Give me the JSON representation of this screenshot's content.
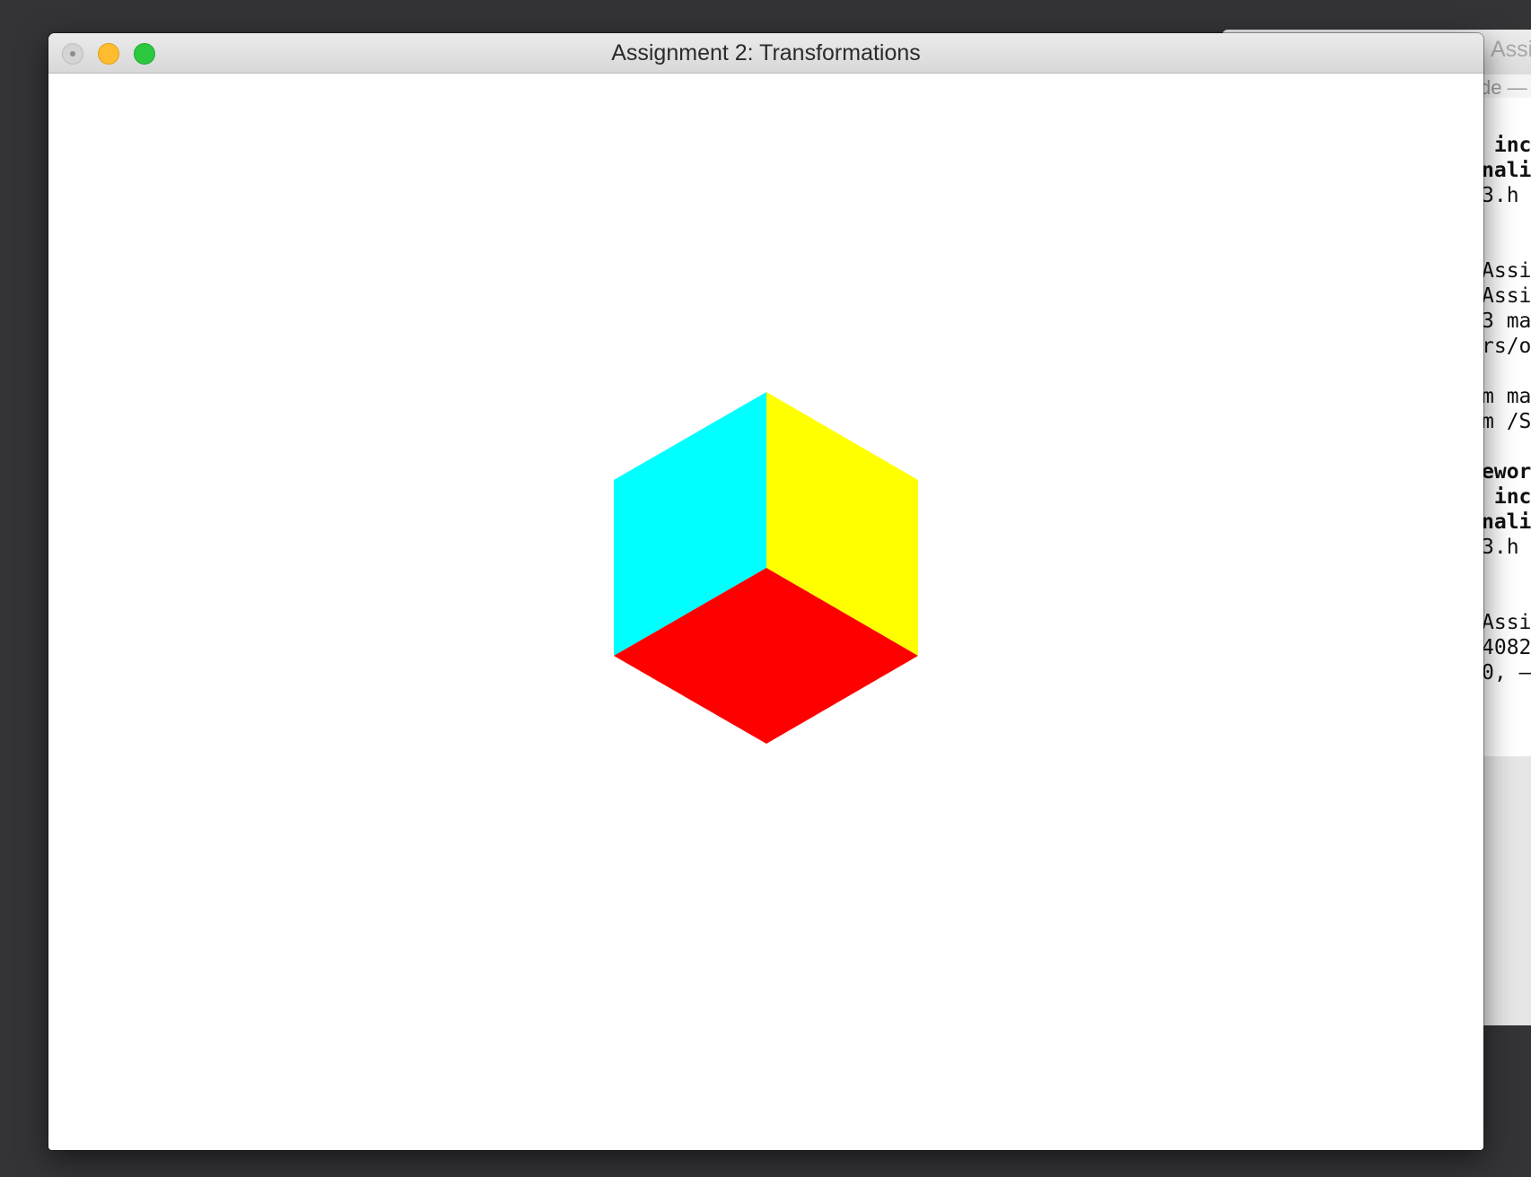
{
  "main_window": {
    "title": "Assignment 2: Transformations",
    "buttons": {
      "close": "close",
      "minimize": "minimize",
      "zoom": "zoom"
    },
    "canvas": {
      "background": "#ffffff",
      "cube_faces": {
        "left": "#00ffff",
        "right": "#ffff00",
        "bottom": "#ff0000"
      }
    }
  },
  "background_window": {
    "title": "Assi",
    "subtitle": "de —",
    "terminal_lines": [
      {
        "text": " inc",
        "bold": true
      },
      {
        "text": "nali",
        "bold": true
      },
      {
        "text": "3.h",
        "bold": false
      },
      {
        "text": "",
        "bold": false
      },
      {
        "text": "",
        "bold": false
      },
      {
        "text": "Assi",
        "bold": false
      },
      {
        "text": "Assi",
        "bold": false
      },
      {
        "text": "3 ma",
        "bold": false
      },
      {
        "text": "rs/o",
        "bold": false
      },
      {
        "text": "",
        "bold": false
      },
      {
        "text": "m ma",
        "bold": false
      },
      {
        "text": "m /S",
        "bold": false
      },
      {
        "text": "",
        "bold": false
      },
      {
        "text": "ewor",
        "bold": true
      },
      {
        "text": " inc",
        "bold": true
      },
      {
        "text": "nali",
        "bold": true
      },
      {
        "text": "3.h",
        "bold": false
      },
      {
        "text": "",
        "bold": false
      },
      {
        "text": "",
        "bold": false
      },
      {
        "text": "Assi",
        "bold": false
      },
      {
        "text": "4082",
        "bold": false
      },
      {
        "text": "0, –",
        "bold": false
      }
    ]
  }
}
